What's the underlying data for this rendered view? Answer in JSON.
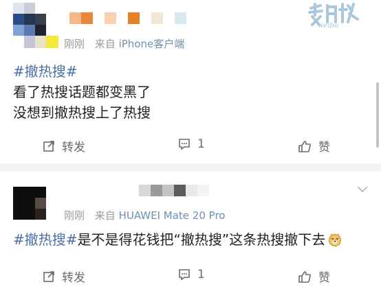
{
  "brand": {
    "logo_text": "weibo"
  },
  "posts": [
    {
      "time": "刚刚",
      "source_prefix": "来自",
      "source_device": "iPhone客户端",
      "hashtag": "#撤热搜#",
      "lines": [
        "看了热搜话题都变黑了",
        "没想到撤热搜上了热搜"
      ],
      "actions": {
        "repost": "转发",
        "comment_count": "1",
        "like": "赞"
      }
    },
    {
      "time": "刚刚",
      "source_prefix": "来自",
      "source_device": "HUAWEI Mate 20 Pro",
      "hashtag": "#撤热搜#",
      "text": "是不是得花钱把“撤热搜”这条热搜撤下去",
      "emoji": "doge-emoji",
      "actions": {
        "repost": "转发",
        "comment_count": "1",
        "like": "赞"
      }
    }
  ],
  "colors": {
    "hashtag": "#4a6fa6",
    "source": "#6e8fb3",
    "meta": "#9b9b9b",
    "divider": "#f2f2f2"
  }
}
